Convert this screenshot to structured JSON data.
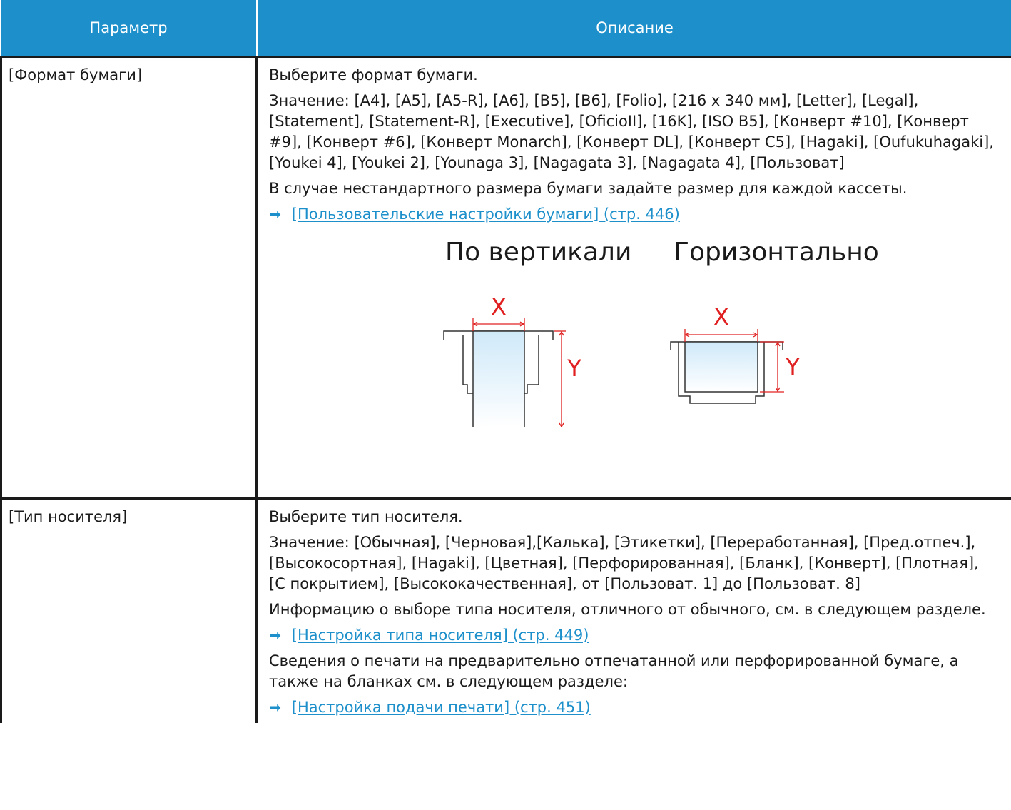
{
  "table": {
    "headers": [
      "Параметр",
      "Описание"
    ],
    "row1": {
      "name": "[Формат бумаги]",
      "desc1": "Выберите формат бумаги.",
      "desc2": "Значение: [A4], [A5], [A5-R], [A6], [B5], [B6], [Folio], [216 x 340 мм], [Letter], [Legal], [Statement], [Statement-R], [Executive], [OficioII], [16K], [ISO B5], [Конверт #10], [Конверт #9], [Конверт #6], [Конверт Monarch], [Конверт DL], [Конверт C5], [Hagaki], [Oufukuhagaki], [Youkei 4], [Youkei 2], [Younaga 3], [Nagagata 3], [Nagagata 4], [Пользоват]",
      "desc3": "В случае нестандартного размера бумаги задайте размер для каждой кассеты.",
      "link": "[Пользовательские настройки бумаги] (стр. 446)",
      "figure": {
        "vertical_label": "По вертикали",
        "horizontal_label": "Горизонтально",
        "x_label": "X",
        "y_label": "Y"
      }
    },
    "row2": {
      "name": "[Тип носителя]",
      "desc1": "Выберите тип носителя.",
      "desc2": "Значение: [Обычная], [Черновая],[Калька], [Этикетки], [Переработанная], [Пред.отпеч.], [Высокосортная], [Hagaki], [Цветная], [Перфорированная], [Бланк], [Конверт], [Плотная], [С покрытием], [Высококачественная], от [Пользоват. 1] до [Пользоват. 8]",
      "desc3": "Информацию о выборе типа носителя, отличного от обычного, см. в следующем разделе.",
      "link1": "[Настройка типа носителя] (стр. 449)",
      "desc4": "Сведения о печати на предварительно отпечатанной или перфорированной бумаге, а также на бланках см. в следующем разделе:",
      "link2": "[Настройка подачи печати] (стр. 451)"
    }
  },
  "colors": {
    "header_bg": "#1d90cb",
    "link": "#1d90cb",
    "dimension": "#e02020",
    "paper_gradient_top": "#cfe9f9"
  }
}
